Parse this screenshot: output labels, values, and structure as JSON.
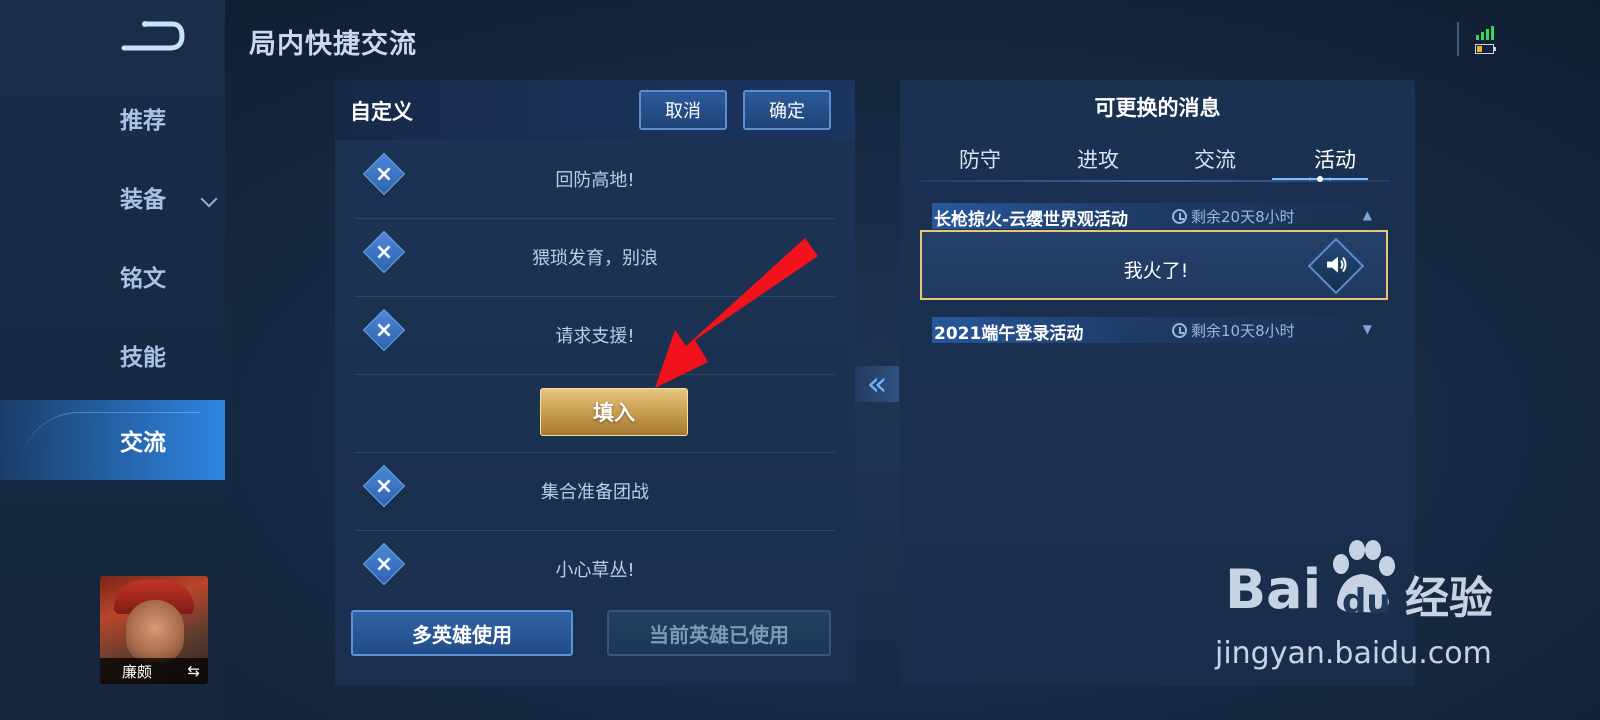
{
  "header": {
    "title": "局内快捷交流"
  },
  "sidebar": {
    "items": [
      {
        "label": "推荐"
      },
      {
        "label": "装备"
      },
      {
        "label": "铭文"
      },
      {
        "label": "技能"
      },
      {
        "label": "交流"
      }
    ],
    "active": "交流",
    "hero": {
      "name": "廉颇",
      "swap_icon": "⇆"
    }
  },
  "custom_panel": {
    "title": "自定义",
    "cancel_label": "取消",
    "confirm_label": "确定",
    "messages": [
      "回防高地!",
      "猥琐发育，别浪",
      "请求支援!",
      "集合准备团战",
      "小心草丛!"
    ],
    "fill_label": "填入",
    "multi_hero_label": "多英雄使用",
    "current_hero_label": "当前英雄已使用"
  },
  "replace_panel": {
    "title": "可更换的消息",
    "tabs": [
      "防守",
      "进攻",
      "交流",
      "活动"
    ],
    "active_tab": "活动",
    "sections": [
      {
        "name": "长枪掠火-云缨世界观活动",
        "time": "剩余20天8小时",
        "expanded": true,
        "items": [
          "我火了!"
        ]
      },
      {
        "name": "2021端午登录活动",
        "time": "剩余10天8小时",
        "expanded": false
      }
    ]
  },
  "watermark": {
    "brand": "Bai",
    "brand_du": "du",
    "product": "经验",
    "url": "jingyan.baidu.com"
  },
  "colors": {
    "accent_gold": "#e8c775",
    "nav_active": "#3a9cff",
    "panel_bg": "#1b3152"
  }
}
